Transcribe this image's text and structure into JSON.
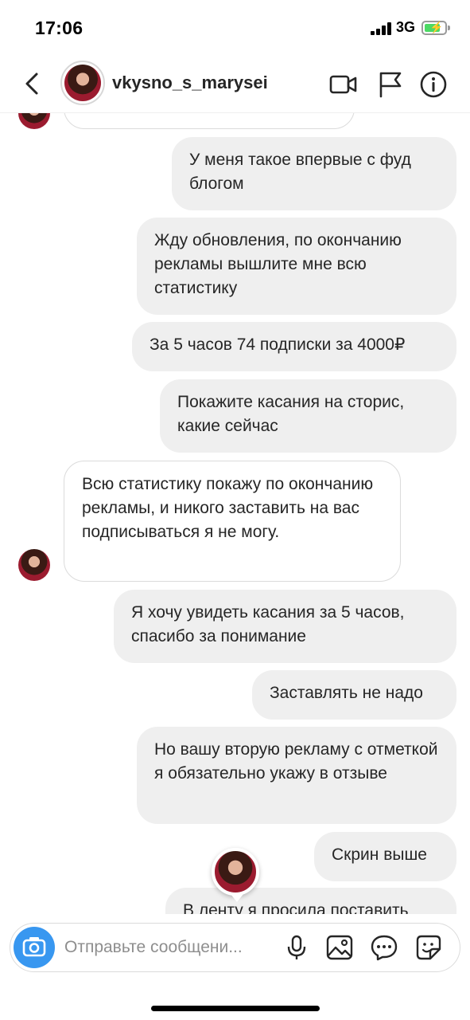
{
  "status_bar": {
    "time": "17:06",
    "network": "3G",
    "battery_level": 0.8,
    "battery_color": "#4cd964"
  },
  "header": {
    "username": "vkysno_s_marysei",
    "icons": [
      "back-icon",
      "video-call-icon",
      "flag-icon",
      "info-icon"
    ]
  },
  "messages": [
    {
      "from": "me",
      "text": "У меня такое впервые с фуд блогом"
    },
    {
      "from": "me",
      "text": "Жду обновления, по окончанию рекламы вышлите мне всю статистику"
    },
    {
      "from": "me",
      "text": "За 5 часов 74 подписки за 4000₽"
    },
    {
      "from": "me",
      "text": "Покажите касания на сторис, какие сейчас"
    },
    {
      "from": "them",
      "text": "Всю статистику покажу по окончанию рекламы, и никого заставить на вас подписываться я не могу."
    },
    {
      "from": "me",
      "text": "Я хочу увидеть касания за 5 часов, спасибо за понимание"
    },
    {
      "from": "me",
      "text": "Заставлять не надо"
    },
    {
      "from": "me",
      "text": "Но вашу вторую рекламу с отметкой я обязательно укажу в отзыве"
    },
    {
      "from": "me",
      "text": "Скрин выше"
    },
    {
      "from": "me",
      "text": "В ленту я просила поставить"
    }
  ],
  "composer": {
    "placeholder": "Отправьте сообщени...",
    "accent_color": "#3897f0",
    "icons": [
      "camera-icon",
      "microphone-icon",
      "gallery-icon",
      "sticker-icon",
      "emoji-sticker-icon"
    ]
  }
}
